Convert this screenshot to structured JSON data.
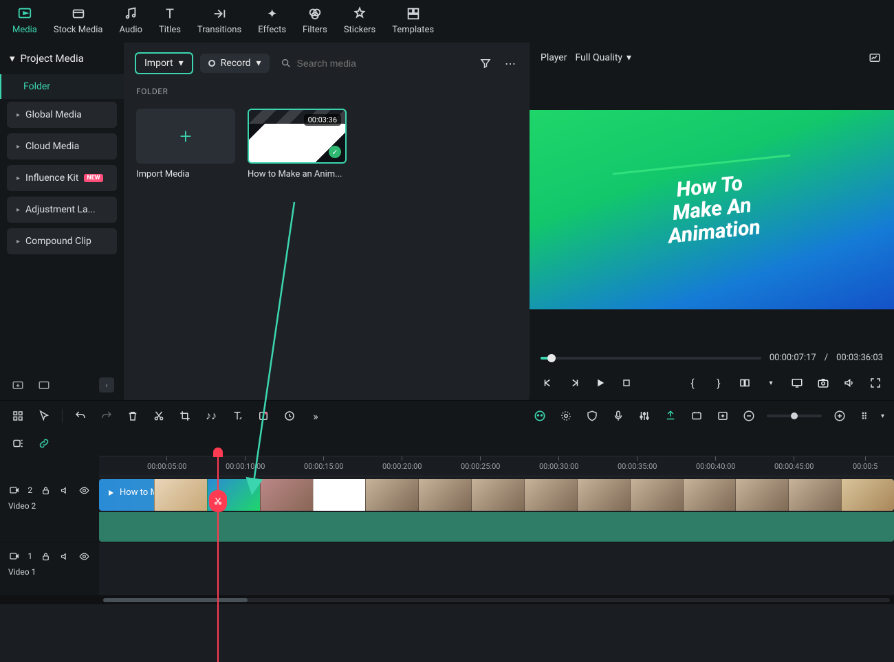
{
  "tabs": [
    {
      "id": "media",
      "label": "Media"
    },
    {
      "id": "stock",
      "label": "Stock Media"
    },
    {
      "id": "audio",
      "label": "Audio"
    },
    {
      "id": "titles",
      "label": "Titles"
    },
    {
      "id": "transitions",
      "label": "Transitions"
    },
    {
      "id": "effects",
      "label": "Effects"
    },
    {
      "id": "filters",
      "label": "Filters"
    },
    {
      "id": "stickers",
      "label": "Stickers"
    },
    {
      "id": "templates",
      "label": "Templates"
    }
  ],
  "sidebar": {
    "header": "Project Media",
    "folder_label": "Folder",
    "items": [
      {
        "label": "Global Media"
      },
      {
        "label": "Cloud Media"
      },
      {
        "label": "Influence Kit",
        "badge": "NEW"
      },
      {
        "label": "Adjustment La..."
      },
      {
        "label": "Compound Clip"
      }
    ]
  },
  "media": {
    "import": "Import",
    "record": "Record",
    "search_placeholder": "Search media",
    "folder_heading": "FOLDER",
    "import_card": "Import Media",
    "clip": {
      "name": "How to Make an Anim...",
      "duration": "00:03:36"
    }
  },
  "player": {
    "title": "Player",
    "quality": "Full Quality",
    "preview_lines": [
      "How To",
      "Make An",
      "Animation"
    ],
    "current_time": "00:00:07:17",
    "separator": "/",
    "total_time": "00:03:36:03"
  },
  "ruler": {
    "ticks": [
      "00:00:05:00",
      "00:00:10:00",
      "00:00:15:00",
      "00:00:20:00",
      "00:00:25:00",
      "00:00:30:00",
      "00:00:35:00",
      "00:00:40:00",
      "00:00:45:00",
      "00:00:5"
    ]
  },
  "tracks": {
    "video2": {
      "num": "2",
      "name": "Video 2",
      "clip_label": "How to Make an Animation"
    },
    "video1": {
      "num": "1",
      "name": "Video 1"
    }
  }
}
